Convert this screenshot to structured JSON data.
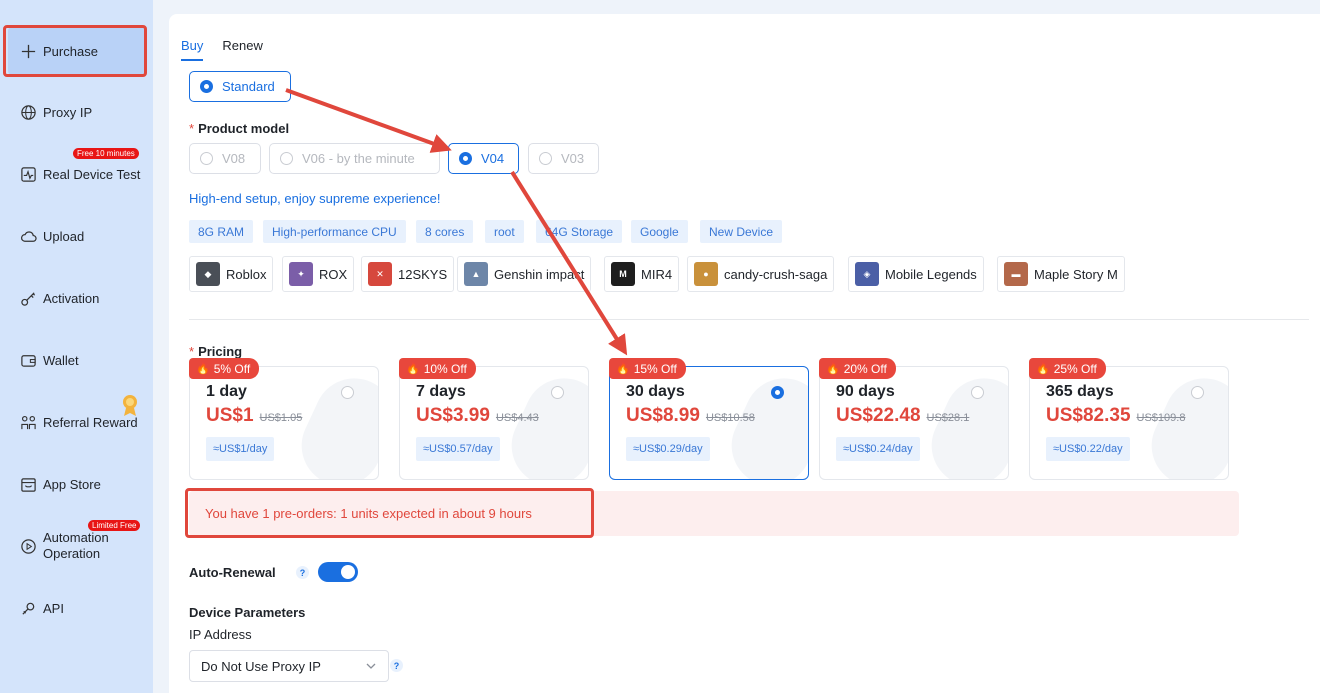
{
  "sidebar": {
    "items": [
      {
        "label": "Purchase",
        "icon": "plus-icon"
      },
      {
        "label": "Proxy IP",
        "icon": "globe-icon"
      },
      {
        "label": "Real Device Test",
        "icon": "pulse-icon",
        "badge": "Free 10 minutes"
      },
      {
        "label": "Upload",
        "icon": "cloud-icon"
      },
      {
        "label": "Activation",
        "icon": "key-icon"
      },
      {
        "label": "Wallet",
        "icon": "wallet-icon"
      },
      {
        "label": "Referral Reward",
        "icon": "people-icon"
      },
      {
        "label": "App Store",
        "icon": "store-icon"
      },
      {
        "label": "Automation Operation",
        "icon": "play-circle-icon",
        "badge": "Limited Free"
      },
      {
        "label": "API",
        "icon": "api-icon"
      }
    ]
  },
  "tabs": {
    "buy": "Buy",
    "renew": "Renew"
  },
  "plan_type": {
    "selected": "Standard"
  },
  "product_model": {
    "label": "Product model",
    "options": [
      "V08",
      "V06 - by the minute",
      "V04",
      "V03"
    ],
    "selected": "V04",
    "tagline": "High-end setup, enjoy supreme experience!",
    "specs": [
      "8G RAM",
      "High-performance CPU",
      "8 cores",
      "root",
      "64G Storage",
      "Google",
      "New Device"
    ]
  },
  "games": [
    "Roblox",
    "ROX",
    "12SKYS",
    "Genshin impact",
    "MIR4",
    "candy-crush-saga",
    "Mobile Legends",
    "Maple Story M"
  ],
  "pricing": {
    "label": "Pricing",
    "plans": [
      {
        "badge": "5% Off",
        "days": "1 day",
        "price": "US$1",
        "original": "US$1.05",
        "per_day": "≈US$1/day"
      },
      {
        "badge": "10% Off",
        "days": "7 days",
        "price": "US$3.99",
        "original": "US$4.43",
        "per_day": "≈US$0.57/day"
      },
      {
        "badge": "15% Off",
        "days": "30 days",
        "price": "US$8.99",
        "original": "US$10.58",
        "per_day": "≈US$0.29/day"
      },
      {
        "badge": "20% Off",
        "days": "90 days",
        "price": "US$22.48",
        "original": "US$28.1",
        "per_day": "≈US$0.24/day"
      },
      {
        "badge": "25% Off",
        "days": "365 days",
        "price": "US$82.35",
        "original": "US$109.8",
        "per_day": "≈US$0.22/day"
      }
    ],
    "selected": "30 days"
  },
  "notice": "You have 1 pre-orders: 1 units expected in about 9 hours",
  "auto_renewal": {
    "label": "Auto-Renewal",
    "help": "?",
    "enabled": true
  },
  "device_parameters": {
    "title": "Device Parameters",
    "ip_label": "IP Address",
    "ip_value": "Do Not Use Proxy IP",
    "help": "?"
  },
  "colors": {
    "accent": "#1a6fe0",
    "danger": "#e0473c",
    "sidebar": "#d4e4fb"
  }
}
